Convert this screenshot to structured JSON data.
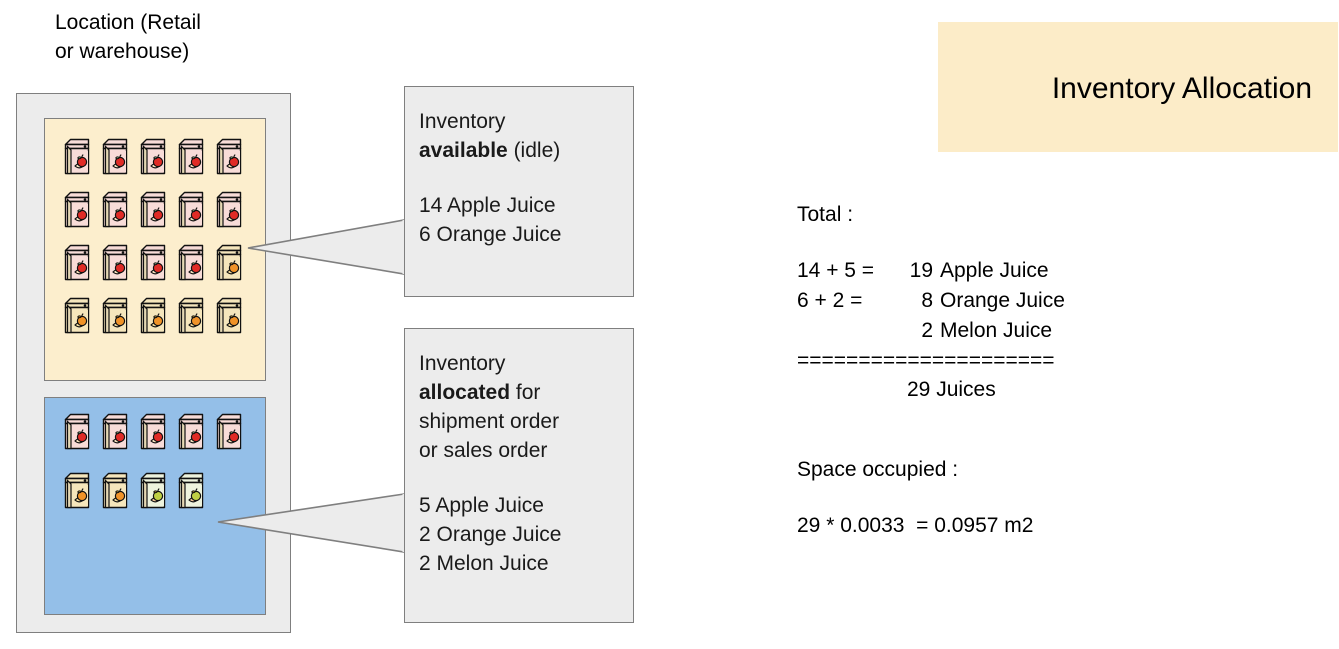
{
  "location": {
    "label": "Location (Retail\nor warehouse)",
    "shelves": [
      {
        "name": "available",
        "background_color": "#fceecd",
        "cartons": [
          "apple",
          "apple",
          "apple",
          "apple",
          "apple",
          "apple",
          "apple",
          "apple",
          "apple",
          "apple",
          "apple",
          "apple",
          "apple",
          "apple",
          "orange",
          "orange",
          "orange",
          "orange",
          "orange",
          "orange"
        ]
      },
      {
        "name": "allocated",
        "background_color": "#94bfe8",
        "cartons": [
          "apple",
          "apple",
          "apple",
          "apple",
          "apple",
          "orange",
          "orange",
          "melon",
          "melon"
        ]
      }
    ]
  },
  "callouts": [
    {
      "id": "available",
      "title_prefix": "Inventory\n",
      "title_bold": "available",
      "title_suffix": " (idle)",
      "quantities": "14 Apple Juice\n6 Orange Juice"
    },
    {
      "id": "allocated",
      "title_prefix": "Inventory\n",
      "title_bold": "allocated",
      "title_suffix": " for\nshipment order\nor sales order",
      "quantities": "5 Apple Juice\n2 Orange Juice\n2 Melon Juice"
    }
  ],
  "panel": {
    "title": "Inventory Allocation",
    "title_background": "#fcecc8",
    "totals_label": "Total :",
    "calc_rows": [
      {
        "lhs": "14 + 5 =",
        "rhs": "19",
        "item": "Apple Juice"
      },
      {
        "lhs": "6 + 2 =",
        "rhs": "8",
        "item": "Orange Juice"
      },
      {
        "lhs": "",
        "rhs": "2",
        "item": "Melon Juice"
      }
    ],
    "divider": "=====================",
    "grand_total": "29 Juices",
    "space_label": "Space occupied :",
    "space_calc": "29 * 0.0033  = 0.0957 m2"
  },
  "carton_colors": {
    "apple": {
      "body": "#f8dcd8",
      "fruit": "#e02b26",
      "leaf": "#9fd39a",
      "slice": "#f7e2c0"
    },
    "orange": {
      "body": "#f5e6bc",
      "fruit": "#f09328",
      "leaf": "#caa23a",
      "slice": "#f0d99a"
    },
    "melon": {
      "body": "#eef3dd",
      "fruit": "#bfd044",
      "leaf": "#cfa23a",
      "slice": "#f0c89a"
    }
  }
}
